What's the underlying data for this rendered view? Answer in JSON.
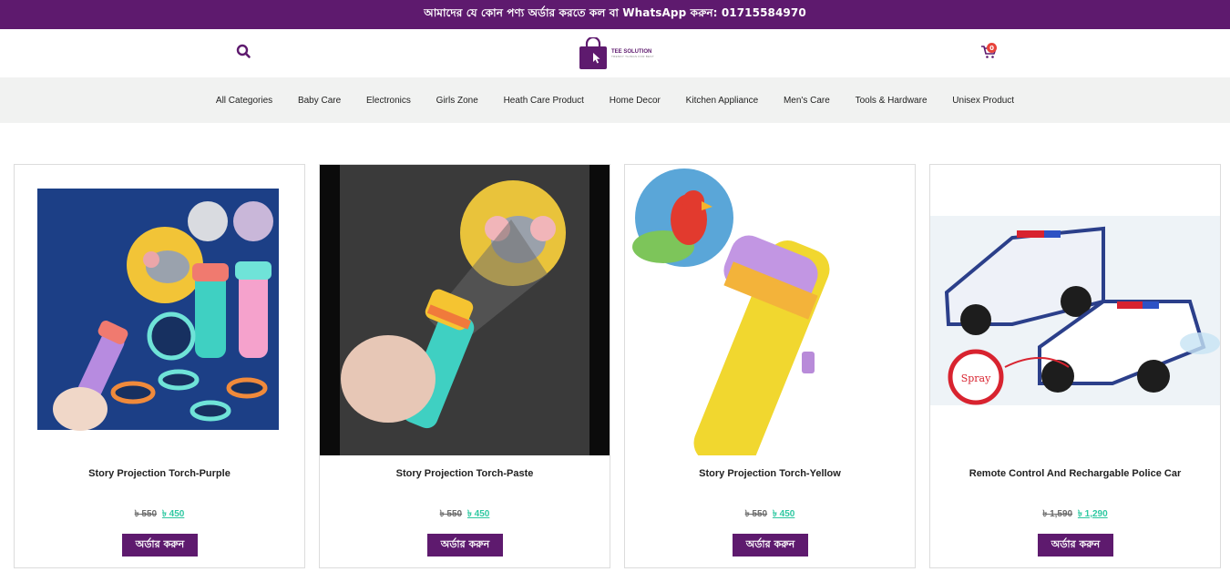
{
  "announcement": "আমাদের যে কোন পণ্য অর্ডার করতে কল বা WhatsApp করুন: 01715584970",
  "header": {
    "logo_text": "TEE SOLUTION",
    "logo_tagline": "TRENDY THINGS FOR BEST",
    "cart_count": "0",
    "search_icon": "search-icon",
    "cart_icon": "cart-icon"
  },
  "categories": [
    "All Categories",
    "Baby Care",
    "Electronics",
    "Girls Zone",
    "Heath Care Product",
    "Home Decor",
    "Kitchen Appliance",
    "Men's Care",
    "Tools & Hardware",
    "Unisex Product"
  ],
  "products": [
    {
      "title": "Story Projection Torch-Purple",
      "old_price": "৳ 550",
      "new_price": "৳ 450",
      "button": "অর্ডার করুন"
    },
    {
      "title": "Story Projection Torch-Paste",
      "old_price": "৳ 550",
      "new_price": "৳ 450",
      "button": "অর্ডার করুন"
    },
    {
      "title": "Story Projection Torch-Yellow",
      "old_price": "৳ 550",
      "new_price": "৳ 450",
      "button": "অর্ডার করুন"
    },
    {
      "title": "Remote Control And Rechargable Police Car",
      "old_price": "৳ 1,590",
      "new_price": "৳ 1,290",
      "button": "অর্ডার করুন"
    }
  ],
  "colors": {
    "brand": "#5e1a6e",
    "sale": "#2ec8a1",
    "badge": "#e8433b",
    "nav_bg": "#f1f2f1"
  }
}
